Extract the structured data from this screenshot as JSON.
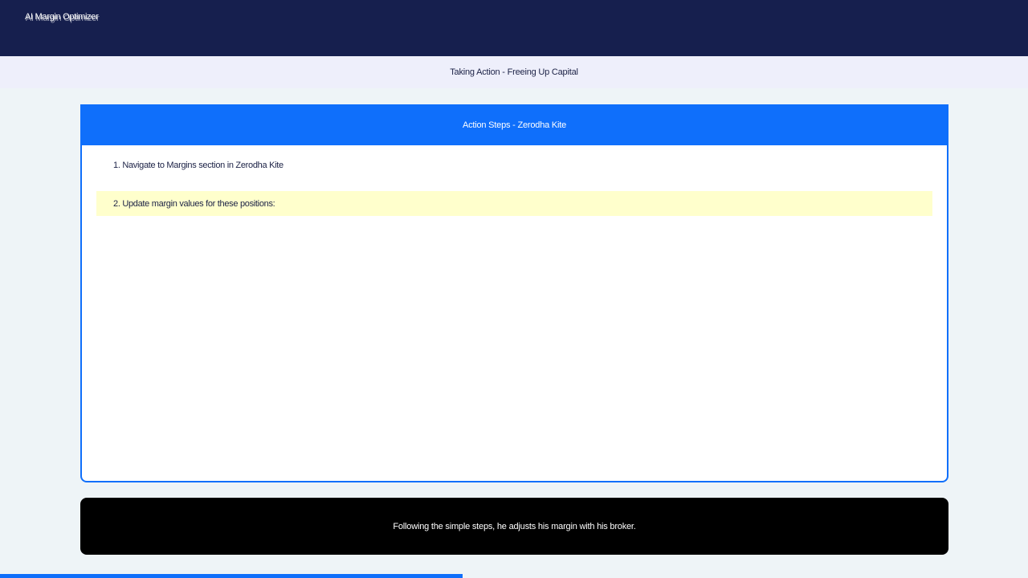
{
  "app": {
    "title": "AI Margin Optimizer"
  },
  "subheader": {
    "title": "Taking Action - Freeing Up Capital"
  },
  "card": {
    "title": "Action Steps - Zerodha Kite",
    "steps": [
      {
        "label": "1. Navigate to Margins section in Zerodha Kite",
        "highlighted": false
      },
      {
        "label": "2. Update margin values for these positions:",
        "highlighted": true
      }
    ]
  },
  "caption": {
    "text": "Following the simple steps, he adjusts his margin with his broker."
  },
  "progress": {
    "fraction": 0.45
  },
  "colors": {
    "topbar": "#161f4e",
    "accent": "#0f6ffb",
    "highlight": "#ffffcc",
    "caption_bg": "#000000"
  }
}
